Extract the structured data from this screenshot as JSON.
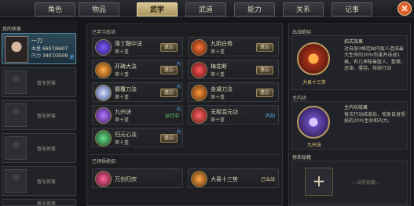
{
  "tabs": [
    {
      "label": "角色"
    },
    {
      "label": "物品"
    },
    {
      "label": "武学"
    },
    {
      "label": "武道"
    },
    {
      "label": "能力"
    },
    {
      "label": "关系"
    },
    {
      "label": "记事"
    }
  ],
  "active_tab": "武学",
  "close_icon": "close-icon",
  "retainers": {
    "title": "我的侠客",
    "hero": {
      "name": "一刀",
      "hp_label": "血量",
      "hp_value": "6607/6607",
      "mp_label": "内力",
      "mp_value": "3407/3509",
      "flag": "通"
    },
    "empty_slots": [
      "暂无侠客",
      "暂无侠客",
      "暂无侠客",
      "暂无侠客",
      "暂无侠客"
    ]
  },
  "learned": {
    "title": "已学习武功",
    "skills": [
      {
        "name": "落丁鞘中法",
        "level": "第十重",
        "button": "遗忘",
        "tag": ""
      },
      {
        "name": "九阴白骨",
        "level": "第十重",
        "button": "遗忘",
        "tag": ""
      },
      {
        "name": "开碑大法",
        "level": "第十重",
        "button": "遗忘",
        "tag": "内"
      },
      {
        "name": "梅花断",
        "level": "第十重",
        "button": "遗忘",
        "tag": ""
      },
      {
        "name": "霸覆刀法",
        "level": "第十重",
        "button": "遗忘",
        "tag": "内"
      },
      {
        "name": "金凝刀法",
        "level": "第十重",
        "button": "遗忘",
        "tag": ""
      },
      {
        "name": "九州诀",
        "level": "第十重",
        "status": "运行中",
        "tag": "内"
      },
      {
        "name": "无极混元功",
        "level": "第十重",
        "status": "内功",
        "tag": ""
      },
      {
        "name": "归元心法",
        "level": "第十重",
        "button": "遗忘",
        "tag": "内"
      }
    ]
  },
  "combos": {
    "title": "已领悟绝招",
    "items": [
      {
        "name": "万剑归宗",
        "status": ""
      },
      {
        "name": "大易十三势",
        "status": "已出战"
      }
    ]
  },
  "right": {
    "combo_title": "出战绝招",
    "combo_icon_label": "大易十三势",
    "combo_desc_title": "招式效果",
    "combo_desc": "对自身3格范围内敌人造成最大生命的30%伤害并击退1格，有几率眩晕敌人、数策、迟滞、僵持，持续行动",
    "inner_title": "主内功",
    "inner_icon_label": "九州诀",
    "inner_desc_title": "主内功效果",
    "inner_desc": "每次行动结束后，恢复自身受损的20%生命和内力。",
    "practice_title": "修炼秘籍",
    "practice_placeholder": "—当前秘籍—"
  },
  "colors": {
    "accent_gold": "#d7c593",
    "running_green": "#6ad26a",
    "inner_blue": "#5ab6ff"
  }
}
